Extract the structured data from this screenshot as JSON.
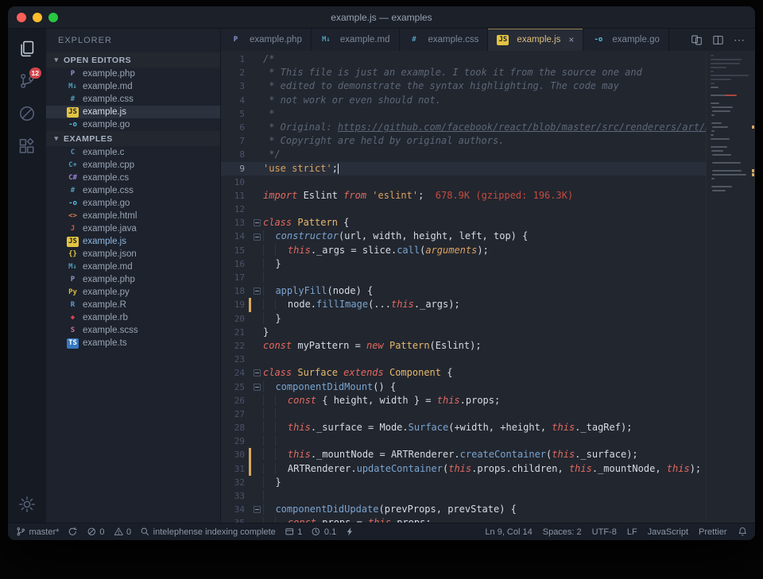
{
  "window": {
    "title": "example.js — examples"
  },
  "colors": {
    "editor_bg": "#22262f",
    "sidebar_bg": "#1d222c",
    "activity_bg": "#151a23",
    "titlebar_bg": "#1b2029",
    "statusbar_bg": "#191e28",
    "comment": "#5c6777",
    "string": "#dda25f",
    "keyword": "#e0695f",
    "function": "#7aa4cf",
    "class_name": "#e6b96a",
    "import_cost": "#c44b40",
    "modified_marker": "#d7a85f",
    "badge_bg": "#d0454c",
    "traffic_close": "#ff5f57",
    "traffic_min": "#febc2e",
    "traffic_zoom": "#28c840"
  },
  "activity_bar": {
    "source_control_badge": "12"
  },
  "sidebar": {
    "title": "EXPLORER",
    "chevron": "▾",
    "open_editors": {
      "label": "OPEN EDITORS",
      "items": [
        {
          "label": "example.php",
          "icon": {
            "glyph": "P",
            "color": "#8b93cf"
          }
        },
        {
          "label": "example.md",
          "icon": {
            "glyph": "M↓",
            "color": "#519aba"
          }
        },
        {
          "label": "example.css",
          "icon": {
            "glyph": "#",
            "color": "#519aba"
          }
        },
        {
          "label": "example.js",
          "icon": {
            "glyph": "JS",
            "color": "#20242c",
            "bg": "#e3c441"
          },
          "selected": true
        },
        {
          "label": "example.go",
          "icon": {
            "glyph": "-o",
            "color": "#4fc4e8"
          }
        }
      ]
    },
    "examples": {
      "label": "EXAMPLES",
      "items": [
        {
          "label": "example.c",
          "icon": {
            "glyph": "C",
            "color": "#519aba"
          }
        },
        {
          "label": "example.cpp",
          "icon": {
            "glyph": "C+",
            "color": "#519aba"
          }
        },
        {
          "label": "example.cs",
          "icon": {
            "glyph": "C#",
            "color": "#9b7fd4"
          }
        },
        {
          "label": "example.css",
          "icon": {
            "glyph": "#",
            "color": "#519aba"
          }
        },
        {
          "label": "example.go",
          "icon": {
            "glyph": "-o",
            "color": "#4fc4e8"
          }
        },
        {
          "label": "example.html",
          "icon": {
            "glyph": "<>",
            "color": "#e07c4c"
          }
        },
        {
          "label": "example.java",
          "icon": {
            "glyph": "J",
            "color": "#d6564c"
          }
        },
        {
          "label": "example.js",
          "icon": {
            "glyph": "JS",
            "color": "#20242c",
            "bg": "#e3c441"
          },
          "accent": true
        },
        {
          "label": "example.json",
          "icon": {
            "glyph": "{}",
            "color": "#e3c441"
          }
        },
        {
          "label": "example.md",
          "icon": {
            "glyph": "M↓",
            "color": "#519aba"
          }
        },
        {
          "label": "example.php",
          "icon": {
            "glyph": "P",
            "color": "#8b93cf"
          }
        },
        {
          "label": "example.py",
          "icon": {
            "glyph": "Py",
            "color": "#d8b73f"
          }
        },
        {
          "label": "example.R",
          "icon": {
            "glyph": "R",
            "color": "#5a9fd4"
          }
        },
        {
          "label": "example.rb",
          "icon": {
            "glyph": "◆",
            "color": "#d6454f"
          }
        },
        {
          "label": "example.scss",
          "icon": {
            "glyph": "S",
            "color": "#d16b9b"
          }
        },
        {
          "label": "example.ts",
          "icon": {
            "glyph": "TS",
            "color": "#ffffff",
            "bg": "#3878c0"
          }
        }
      ]
    }
  },
  "tabbar": {
    "close_glyph": "×",
    "more_glyph": "⋯"
  },
  "tabs": [
    {
      "label": "example.php",
      "icon": {
        "glyph": "P",
        "color": "#8b93cf"
      }
    },
    {
      "label": "example.md",
      "icon": {
        "glyph": "M↓",
        "color": "#519aba"
      }
    },
    {
      "label": "example.css",
      "icon": {
        "glyph": "#",
        "color": "#519aba"
      }
    },
    {
      "label": "example.js",
      "icon": {
        "glyph": "JS",
        "color": "#20242c",
        "bg": "#e3c441"
      },
      "active": true
    },
    {
      "label": "example.go",
      "icon": {
        "glyph": "-o",
        "color": "#4fc4e8"
      }
    }
  ],
  "editor": {
    "cursor_line": 9,
    "modified_lines": [
      19,
      30,
      31
    ],
    "fold_lines": [
      13,
      14,
      18,
      24,
      25,
      34
    ],
    "lines": [
      [
        [
          "cm",
          "/*"
        ]
      ],
      [
        [
          "cm",
          " * This file is just an example. I took it from the source one and"
        ]
      ],
      [
        [
          "cm",
          " * edited to demonstrate the syntax highlighting. The code may"
        ]
      ],
      [
        [
          "cm",
          " * not work or even should not."
        ]
      ],
      [
        [
          "cm",
          " *"
        ]
      ],
      [
        [
          "cm",
          " * Original: "
        ],
        [
          "cml",
          "https://github.com/facebook/react/blob/master/src/renderers/art/ReactART.js"
        ]
      ],
      [
        [
          "cm",
          " * Copyright are held by original authors."
        ]
      ],
      [
        [
          "cm",
          " */"
        ]
      ],
      [
        [
          "str",
          "'use strict'"
        ],
        [
          "pl",
          ";"
        ],
        [
          "cur",
          ""
        ]
      ],
      [],
      [
        [
          "kw",
          "import"
        ],
        [
          "pl",
          " Eslint "
        ],
        [
          "kw",
          "from"
        ],
        [
          "pl",
          " "
        ],
        [
          "str",
          "'eslint'"
        ],
        [
          "pl",
          ";"
        ],
        [
          "cost",
          "  678.9K (gzipped: 196.3K)"
        ]
      ],
      [],
      [
        [
          "kw",
          "class"
        ],
        [
          "pl",
          " "
        ],
        [
          "cls",
          "Pattern"
        ],
        [
          "pl",
          " {"
        ]
      ],
      [
        [
          "g",
          "  "
        ],
        [
          "fn it",
          "constructor"
        ],
        [
          "pl",
          "(url, width, height, left, top) {"
        ]
      ],
      [
        [
          "g",
          "  "
        ],
        [
          "g",
          "  "
        ],
        [
          "kw",
          "this"
        ],
        [
          "pl",
          "._args = slice."
        ],
        [
          "fn",
          "call"
        ],
        [
          "pl",
          "("
        ],
        [
          "arg",
          "arguments"
        ],
        [
          "pl",
          ");"
        ]
      ],
      [
        [
          "g",
          "  "
        ],
        [
          "pl",
          "}"
        ]
      ],
      [
        [
          "g",
          "  "
        ]
      ],
      [
        [
          "g",
          "  "
        ],
        [
          "fn",
          "applyFill"
        ],
        [
          "pl",
          "(node) {"
        ]
      ],
      [
        [
          "g",
          "  "
        ],
        [
          "g",
          "  "
        ],
        [
          "pl",
          "node."
        ],
        [
          "fn",
          "fillImage"
        ],
        [
          "pl",
          "(..."
        ],
        [
          "kw",
          "this"
        ],
        [
          "pl",
          "._args);"
        ]
      ],
      [
        [
          "g",
          "  "
        ],
        [
          "pl",
          "}"
        ]
      ],
      [
        [
          "pl",
          "}"
        ]
      ],
      [
        [
          "kw",
          "const"
        ],
        [
          "pl",
          " myPattern = "
        ],
        [
          "kw",
          "new"
        ],
        [
          "pl",
          " "
        ],
        [
          "cls",
          "Pattern"
        ],
        [
          "pl",
          "(Eslint);"
        ]
      ],
      [],
      [
        [
          "kw",
          "class"
        ],
        [
          "pl",
          " "
        ],
        [
          "cls",
          "Surface"
        ],
        [
          "pl",
          " "
        ],
        [
          "kw",
          "extends"
        ],
        [
          "pl",
          " "
        ],
        [
          "cls",
          "Component"
        ],
        [
          "pl",
          " {"
        ]
      ],
      [
        [
          "g",
          "  "
        ],
        [
          "fn",
          "componentDidMount"
        ],
        [
          "pl",
          "() {"
        ]
      ],
      [
        [
          "g",
          "  "
        ],
        [
          "g",
          "  "
        ],
        [
          "kw",
          "const"
        ],
        [
          "pl",
          " { height, width } = "
        ],
        [
          "kw",
          "this"
        ],
        [
          "pl",
          ".props;"
        ]
      ],
      [
        [
          "g",
          "  "
        ],
        [
          "g",
          "  "
        ]
      ],
      [
        [
          "g",
          "  "
        ],
        [
          "g",
          "  "
        ],
        [
          "kw",
          "this"
        ],
        [
          "pl",
          "._surface = Mode."
        ],
        [
          "fn",
          "Surface"
        ],
        [
          "pl",
          "(+width, +height, "
        ],
        [
          "kw",
          "this"
        ],
        [
          "pl",
          "._tagRef);"
        ]
      ],
      [
        [
          "g",
          "  "
        ],
        [
          "g",
          "  "
        ]
      ],
      [
        [
          "g",
          "  "
        ],
        [
          "g",
          "  "
        ],
        [
          "kw",
          "this"
        ],
        [
          "pl",
          "._mountNode = ARTRenderer."
        ],
        [
          "fn",
          "createContainer"
        ],
        [
          "pl",
          "("
        ],
        [
          "kw",
          "this"
        ],
        [
          "pl",
          "._surface);"
        ]
      ],
      [
        [
          "g",
          "  "
        ],
        [
          "g",
          "  "
        ],
        [
          "pl",
          "ARTRenderer."
        ],
        [
          "fn",
          "updateContainer"
        ],
        [
          "pl",
          "("
        ],
        [
          "kw",
          "this"
        ],
        [
          "pl",
          ".props.children, "
        ],
        [
          "kw",
          "this"
        ],
        [
          "pl",
          "._mountNode, "
        ],
        [
          "kw",
          "this"
        ],
        [
          "pl",
          ");"
        ]
      ],
      [
        [
          "g",
          "  "
        ],
        [
          "pl",
          "}"
        ]
      ],
      [
        [
          "g",
          "  "
        ]
      ],
      [
        [
          "g",
          "  "
        ],
        [
          "fn",
          "componentDidUpdate"
        ],
        [
          "pl",
          "(prevProps, prevState) {"
        ]
      ],
      [
        [
          "g",
          "  "
        ],
        [
          "g",
          "  "
        ],
        [
          "kw",
          "const"
        ],
        [
          "pl",
          " props = "
        ],
        [
          "kw",
          "this"
        ],
        [
          "pl",
          ".props;"
        ]
      ]
    ]
  },
  "status_bar": {
    "left": [
      {
        "icon": "branch",
        "label": "master*"
      },
      {
        "icon": "sync",
        "label": ""
      },
      {
        "icon": "error",
        "label": "0"
      },
      {
        "icon": "warning",
        "label": "0"
      },
      {
        "icon": "search",
        "label": "intelephense indexing complete"
      },
      {
        "icon": "window",
        "label": "1"
      },
      {
        "icon": "clock",
        "label": "0.1"
      },
      {
        "icon": "zap",
        "label": ""
      }
    ],
    "right": [
      "Ln 9, Col 14",
      "Spaces: 2",
      "UTF-8",
      "LF",
      "JavaScript",
      "Prettier"
    ]
  }
}
